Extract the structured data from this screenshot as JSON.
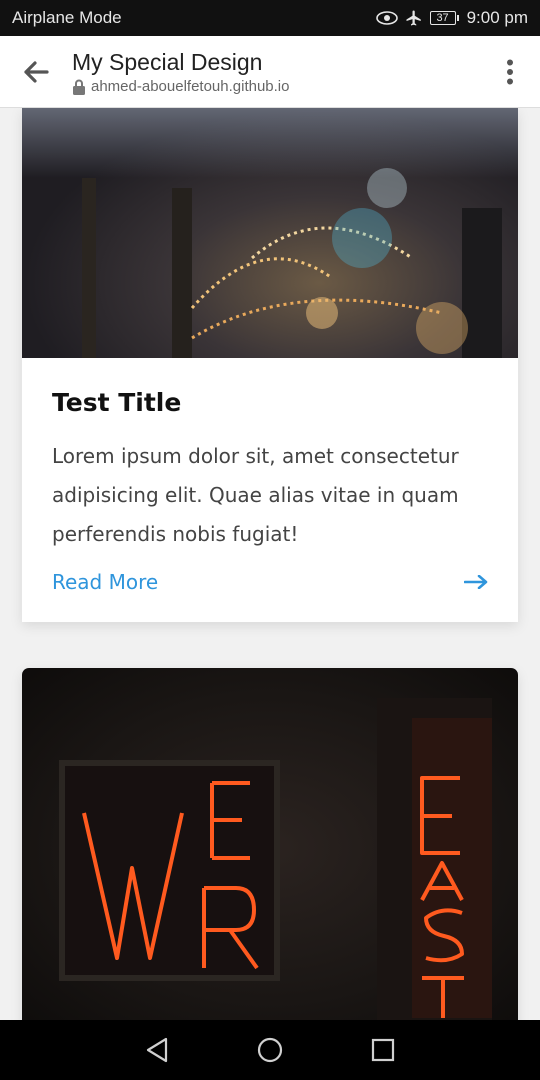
{
  "status_bar": {
    "left_text": "Airplane Mode",
    "battery": "37",
    "time": "9:00 pm"
  },
  "browser": {
    "title": "My Special Design",
    "url": "ahmed-abouelfetouh.github.io"
  },
  "cards": [
    {
      "image_icon": "photo-bokeh-lights",
      "title": "Test Title",
      "text": "Lorem ipsum dolor sit, amet consectetur adipisicing elit. Quae alias vitae in quam perferendis nobis fugiat!",
      "link_label": "Read More",
      "link_icon": "arrow-right-icon"
    },
    {
      "image_icon": "photo-neon-sign"
    }
  ],
  "colors": {
    "accent": "#2f95dc",
    "status_bg": "#111111",
    "nav_bg": "#000000",
    "neon": "#ff5a1f"
  }
}
